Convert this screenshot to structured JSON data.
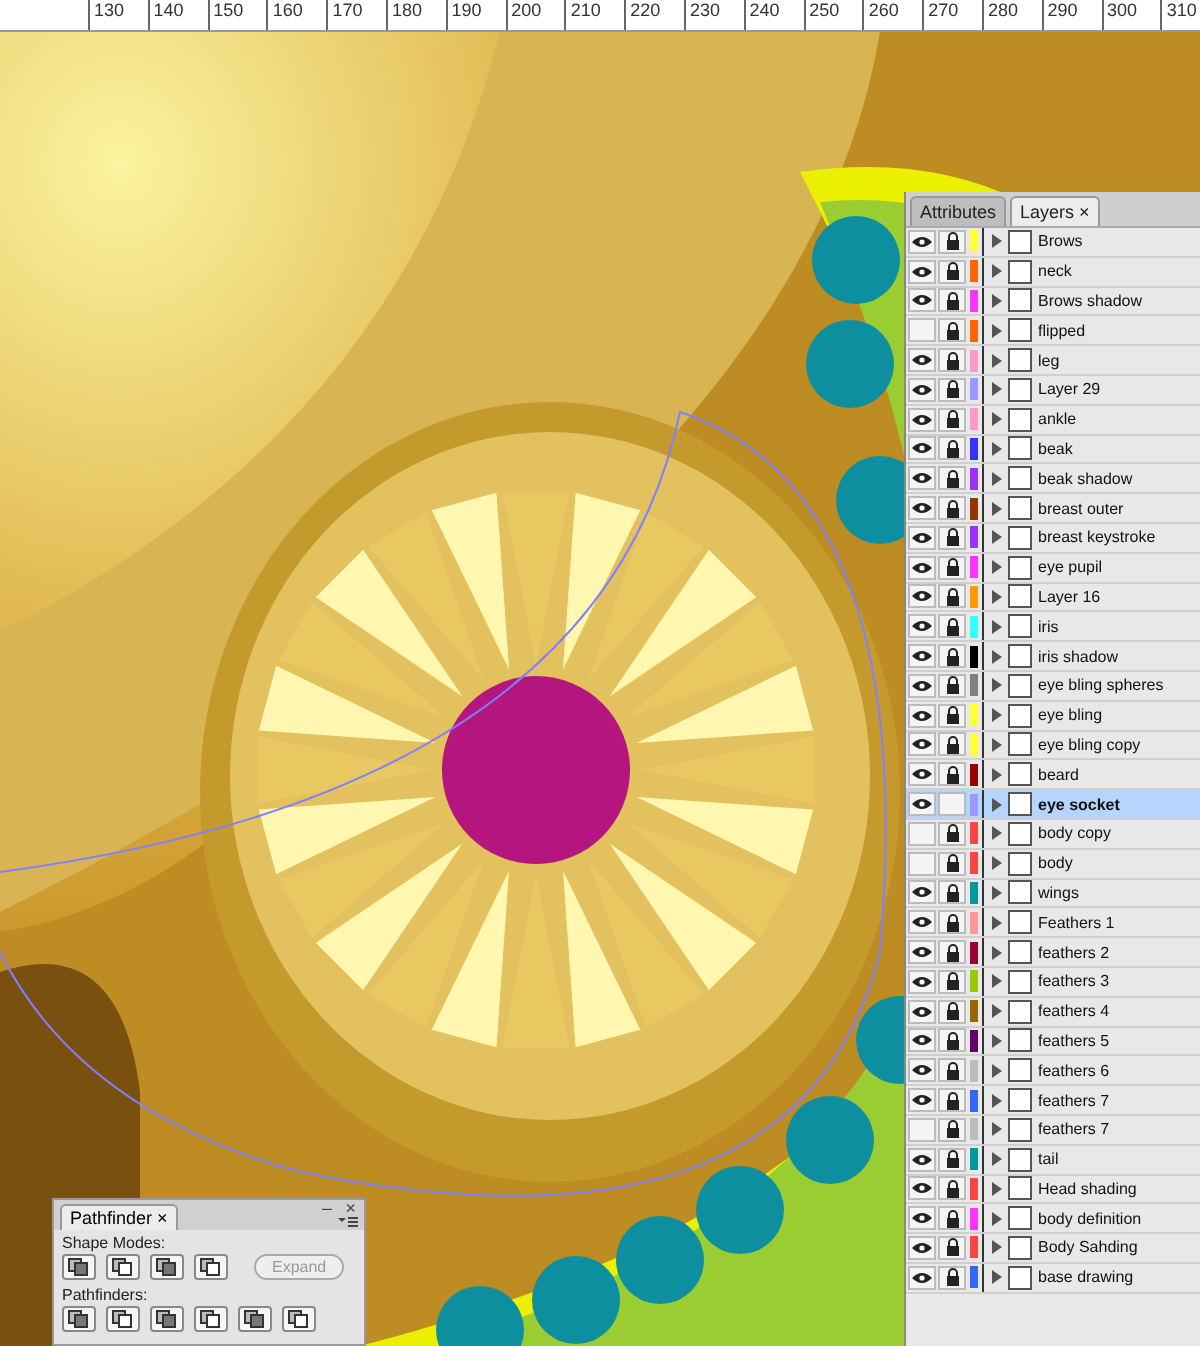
{
  "ruler": {
    "labels": [
      "130",
      "140",
      "150",
      "160",
      "170",
      "180",
      "190",
      "200",
      "210",
      "220",
      "230",
      "240",
      "250",
      "260",
      "270",
      "280",
      "290",
      "300",
      "310"
    ]
  },
  "layers_panel": {
    "tabs": [
      {
        "label": "Attributes",
        "selected": false
      },
      {
        "label": "Layers",
        "selected": true,
        "close": "×"
      }
    ],
    "layers": [
      {
        "name": "Brows",
        "visible": true,
        "locked": true,
        "color": "#ffff33",
        "selected": false
      },
      {
        "name": "neck",
        "visible": true,
        "locked": true,
        "color": "#ff6600",
        "selected": false
      },
      {
        "name": "Brows shadow",
        "visible": true,
        "locked": true,
        "color": "#ff33ff",
        "selected": false
      },
      {
        "name": "flipped",
        "visible": false,
        "locked": true,
        "color": "#ff6600",
        "selected": false
      },
      {
        "name": "leg",
        "visible": true,
        "locked": true,
        "color": "#ff99cc",
        "selected": false
      },
      {
        "name": "Layer 29",
        "visible": true,
        "locked": true,
        "color": "#9999ff",
        "selected": false
      },
      {
        "name": "ankle",
        "visible": true,
        "locked": true,
        "color": "#ff99cc",
        "selected": false
      },
      {
        "name": "beak",
        "visible": true,
        "locked": true,
        "color": "#3333ff",
        "selected": false
      },
      {
        "name": "beak shadow",
        "visible": true,
        "locked": true,
        "color": "#9933ff",
        "selected": false
      },
      {
        "name": "breast outer",
        "visible": true,
        "locked": true,
        "color": "#993300",
        "selected": false
      },
      {
        "name": "breast keystroke",
        "visible": true,
        "locked": true,
        "color": "#9933ff",
        "selected": false
      },
      {
        "name": "eye pupil",
        "visible": true,
        "locked": true,
        "color": "#ff33ff",
        "selected": false
      },
      {
        "name": "Layer 16",
        "visible": true,
        "locked": true,
        "color": "#ff9900",
        "selected": false
      },
      {
        "name": "iris",
        "visible": true,
        "locked": true,
        "color": "#33ffff",
        "selected": false
      },
      {
        "name": "iris shadow",
        "visible": true,
        "locked": true,
        "color": "#000000",
        "selected": false
      },
      {
        "name": "eye bling spheres",
        "visible": true,
        "locked": true,
        "color": "#808080",
        "selected": false
      },
      {
        "name": "eye bling",
        "visible": true,
        "locked": true,
        "color": "#ffff33",
        "selected": false
      },
      {
        "name": "eye bling copy",
        "visible": true,
        "locked": true,
        "color": "#ffff33",
        "selected": false
      },
      {
        "name": "beard",
        "visible": true,
        "locked": true,
        "color": "#990000",
        "selected": false
      },
      {
        "name": "eye socket",
        "visible": true,
        "locked": false,
        "color": "#9999ff",
        "selected": true
      },
      {
        "name": "body copy",
        "visible": false,
        "locked": true,
        "color": "#ff4444",
        "selected": false
      },
      {
        "name": "body",
        "visible": false,
        "locked": true,
        "color": "#ff4444",
        "selected": false
      },
      {
        "name": "wings",
        "visible": true,
        "locked": true,
        "color": "#009999",
        "selected": false
      },
      {
        "name": "Feathers 1",
        "visible": true,
        "locked": true,
        "color": "#ff9999",
        "selected": false
      },
      {
        "name": "feathers 2",
        "visible": true,
        "locked": true,
        "color": "#990033",
        "selected": false
      },
      {
        "name": "feathers 3",
        "visible": true,
        "locked": true,
        "color": "#99cc00",
        "selected": false
      },
      {
        "name": "feathers 4",
        "visible": true,
        "locked": true,
        "color": "#996600",
        "selected": false
      },
      {
        "name": "feathers 5",
        "visible": true,
        "locked": true,
        "color": "#660066",
        "selected": false
      },
      {
        "name": "feathers 6",
        "visible": true,
        "locked": true,
        "color": "#bbbbbb",
        "selected": false
      },
      {
        "name": "feathers 7",
        "visible": true,
        "locked": true,
        "color": "#3366ff",
        "selected": false
      },
      {
        "name": "feathers 7",
        "visible": false,
        "locked": true,
        "color": "#bbbbbb",
        "selected": false
      },
      {
        "name": "tail",
        "visible": true,
        "locked": true,
        "color": "#009999",
        "selected": false
      },
      {
        "name": "Head shading",
        "visible": true,
        "locked": true,
        "color": "#ff4444",
        "selected": false
      },
      {
        "name": "body definition",
        "visible": true,
        "locked": true,
        "color": "#ff33ff",
        "selected": false
      },
      {
        "name": "Body Sahding",
        "visible": true,
        "locked": true,
        "color": "#ff4444",
        "selected": false
      },
      {
        "name": "base drawing",
        "visible": true,
        "locked": true,
        "color": "#3366ff",
        "selected": false
      }
    ]
  },
  "pathfinder_panel": {
    "tab": "Pathfinder",
    "close": "×",
    "minimize": "–",
    "window_close": "×",
    "shape_modes_label": "Shape Modes:",
    "expand_button": {
      "label": "Expand",
      "disabled": true
    },
    "pathfinders_label": "Pathfinders:"
  }
}
